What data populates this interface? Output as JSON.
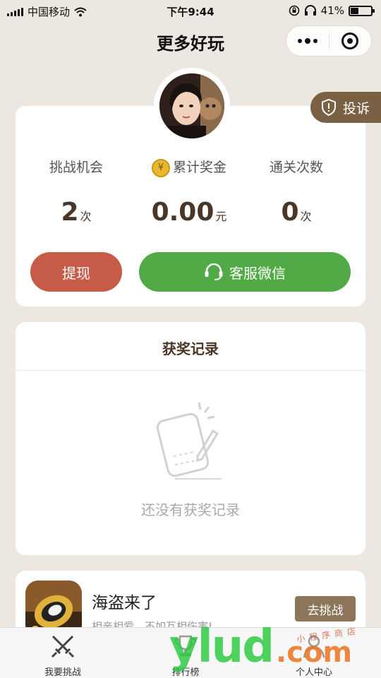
{
  "status_bar": {
    "carrier": "中国移动",
    "time": "下午9:44",
    "battery_pct": "41%",
    "battery_level": 0.41
  },
  "nav": {
    "title": "更多好玩"
  },
  "complaint": {
    "label": "投诉"
  },
  "stats": {
    "chances": {
      "label": "挑战机会",
      "value": "2",
      "unit": "次"
    },
    "prize": {
      "label": "累计奖金",
      "value": "0.00",
      "unit": "元",
      "coin_glyph": "¥"
    },
    "clears": {
      "label": "通关次数",
      "value": "0",
      "unit": "次"
    }
  },
  "buttons": {
    "withdraw": "提现",
    "service": "客服微信"
  },
  "records": {
    "title": "获奖记录",
    "empty_text": "还没有获奖记录"
  },
  "game": {
    "title": "海盗来了",
    "subtitle": "相亲相爱，不如互相伤害!",
    "action": "去挑战"
  },
  "tabs": {
    "challenge": "我要挑战",
    "ranking": "排行榜",
    "profile": "个人中心"
  },
  "watermark": {
    "main": "ylud",
    "suffix": ".com",
    "small": "小程序商店"
  },
  "colors": {
    "brown": "#7b6144",
    "red": "#c65c48",
    "green": "#52aa46",
    "bg": "#ece8e1"
  },
  "icons": [
    "wifi-icon",
    "lock-rotation-icon",
    "headphones-icon",
    "more-dots-icon",
    "close-target-icon",
    "shield-icon",
    "coin-icon",
    "headset-icon",
    "empty-document-icon",
    "crossed-swords-icon",
    "trophy-icon",
    "person-icon"
  ]
}
